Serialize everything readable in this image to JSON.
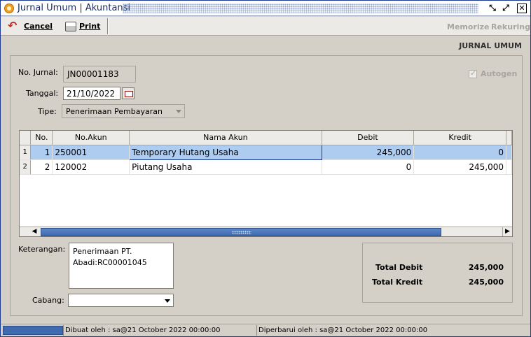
{
  "window": {
    "title": "Jurnal Umum | Akuntansi",
    "minimize_icon": "minimize-restore-icon",
    "maximize_icon": "maximize-icon",
    "close_icon": "close-icon"
  },
  "toolbar": {
    "cancel_label": "Cancel",
    "print_label": "Print",
    "memorize_label": "Memorize",
    "rekuring_label": "Rekuring"
  },
  "header": {
    "title": "JURNAL UMUM"
  },
  "form": {
    "no_jurnal_label": "No. Jurnal:",
    "no_jurnal_value": "JN00001183",
    "tanggal_label": "Tanggal:",
    "tanggal_value": "21/10/2022",
    "tipe_label": "Tipe:",
    "tipe_value": "Penerimaan Pembayaran",
    "autogen_label": "Autogen",
    "keterangan_label": "Keterangan:",
    "keterangan_value": "Penerimaan PT.\nAbadi:RC00001045",
    "cabang_label": "Cabang:",
    "cabang_value": ""
  },
  "grid": {
    "columns": [
      "No.",
      "No.Akun",
      "Nama Akun",
      "Debit",
      "Kredit"
    ],
    "rows": [
      {
        "row_index": "1",
        "no": "1",
        "no_akun": "250001",
        "nama_akun": "Temporary Hutang Usaha",
        "debit": "245,000",
        "kredit": "0"
      },
      {
        "row_index": "2",
        "no": "2",
        "no_akun": "120002",
        "nama_akun": "Piutang Usaha",
        "debit": "0",
        "kredit": "245,000"
      }
    ]
  },
  "totals": {
    "debit_label": "Total Debit",
    "debit_value": "245,000",
    "kredit_label": "Total Kredit",
    "kredit_value": "245,000"
  },
  "status": {
    "created": "Dibuat oleh : sa@21 October 2022  00:00:00",
    "updated": "Diperbarui oleh : sa@21 October 2022  00:00:00"
  },
  "colors": {
    "selection": "#aeccf0",
    "scroll_thumb": "#3f6ab0",
    "window_bg": "#d4d0c8"
  }
}
